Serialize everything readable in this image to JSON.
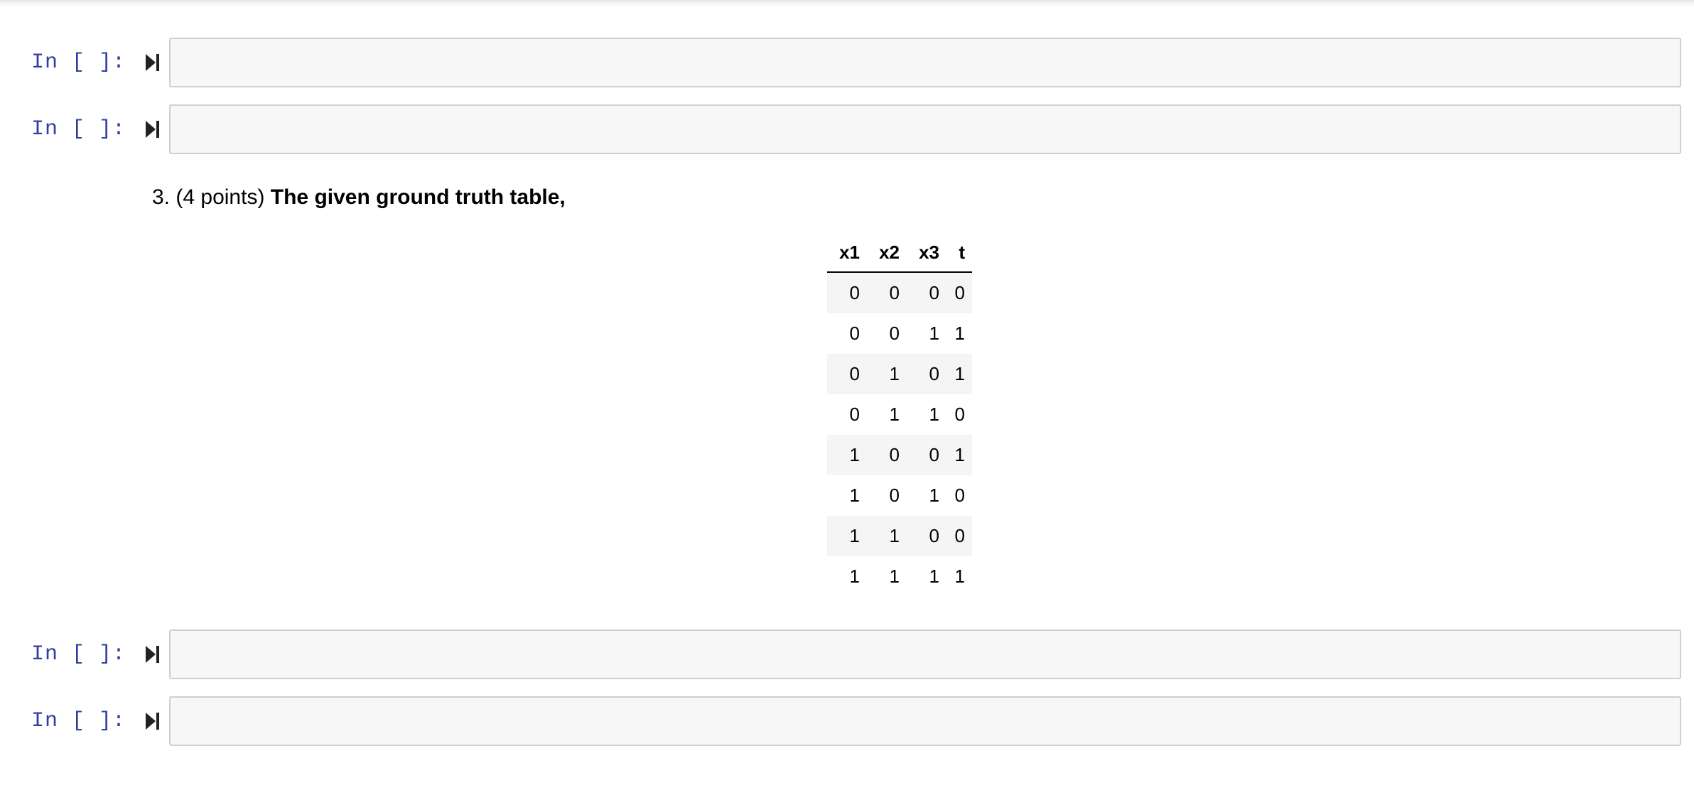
{
  "cells_before": [
    {
      "prompt": "In [ ]:"
    },
    {
      "prompt": "In [ ]:"
    }
  ],
  "markdown": {
    "question_number": "3.",
    "points": "(4 points)",
    "question_bold": "The given ground truth table,",
    "table": {
      "headers": [
        "x1",
        "x2",
        "x3",
        "t"
      ],
      "rows": [
        [
          "0",
          "0",
          "0",
          "0"
        ],
        [
          "0",
          "0",
          "1",
          "1"
        ],
        [
          "0",
          "1",
          "0",
          "1"
        ],
        [
          "0",
          "1",
          "1",
          "0"
        ],
        [
          "1",
          "0",
          "0",
          "1"
        ],
        [
          "1",
          "0",
          "1",
          "0"
        ],
        [
          "1",
          "1",
          "0",
          "0"
        ],
        [
          "1",
          "1",
          "1",
          "1"
        ]
      ]
    }
  },
  "cells_after": [
    {
      "prompt": "In [ ]:"
    },
    {
      "prompt": "In [ ]:"
    }
  ],
  "colors": {
    "prompt": "#303f9f",
    "input_bg": "#f7f7f7",
    "input_border": "#cfcfcf",
    "row_stripe": "#f5f5f5"
  },
  "icons": {
    "run": "run-cell-icon"
  }
}
